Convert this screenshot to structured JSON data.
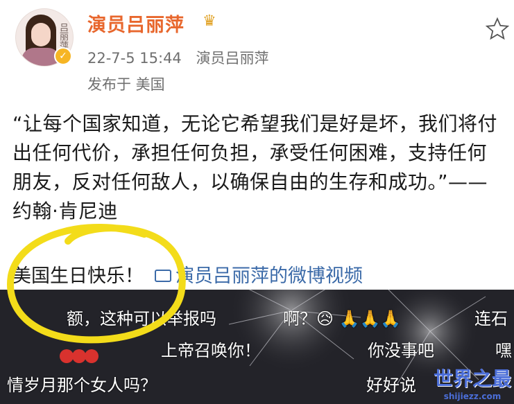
{
  "post": {
    "author": "演员吕丽萍",
    "timestamp": "22-7-5 15:44",
    "source": "演员吕丽萍",
    "location": "发布于 美国",
    "avatar_signature": "吕丽萍",
    "quote": "“让每个国家知道，无论它希望我们是好是坏，我们将付出任何代价，承担任何负担，承受任何困难，支持任何朋友，反对任何敌人，以确保自由的生存和成功。”——约翰·肯尼迪",
    "birthday_text": "美国生日快乐！",
    "video_link": "演员吕丽萍的微博视频"
  },
  "video": {
    "danmu": [
      "额，这种可以举报吗",
      "啊？😥 🙏🙏🙏",
      "连石",
      "上帝召唤你！",
      "你没事吧",
      "嘿",
      "情岁月那个女人吗？",
      "好好说"
    ]
  },
  "watermark": {
    "cn": "世界之最",
    "url": "shijiezz.com"
  },
  "colors": {
    "author": "#e8672d",
    "link": "#3b6aa8",
    "circle": "#f3dc1a",
    "video_bg": "#1f1f24"
  }
}
